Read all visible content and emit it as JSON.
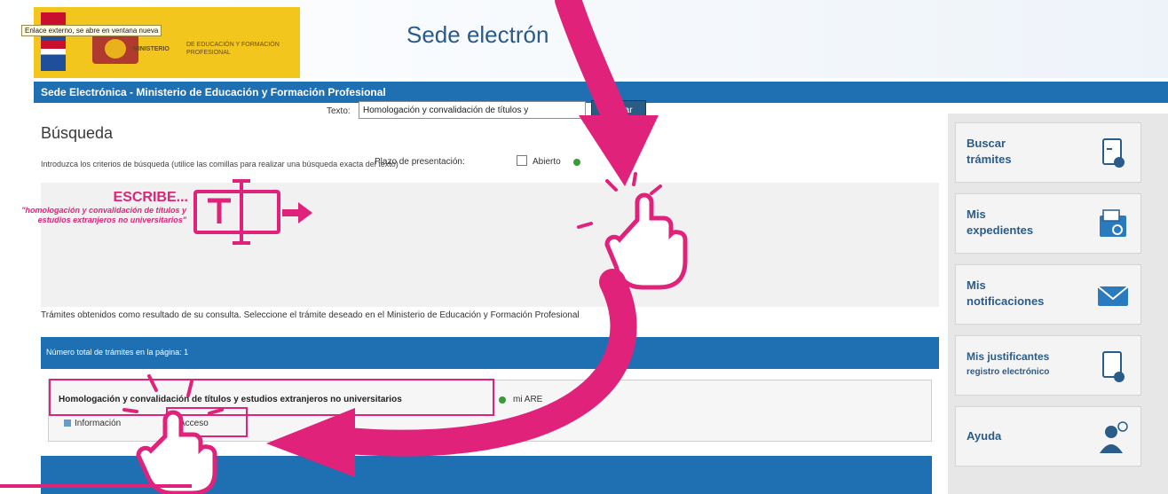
{
  "header": {
    "tooltip": "Enlace externo, se abre en ventana nueva",
    "logo_line1": "MINISTERIO",
    "logo_line2": "DE EDUCACIÓN Y FORMACIÓN PROFESIONAL",
    "site_title": "Sede electrón"
  },
  "bluebar": {
    "title": "Sede Electrónica - Ministerio de Educación y Formación Profesional"
  },
  "main": {
    "heading": "Búsqueda",
    "intro": "Introduzca los criterios de búsqueda (utilice las comillas para realizar una búsqueda exacta del texto)",
    "texto_label": "Texto:",
    "texto_value": "Homologación y convalidación de títulos y",
    "buscar_label": "Buscar",
    "plazo_label": "Plazo de presentación:",
    "abierto_label": "Abierto",
    "results_text": "Trámites obtenidos como resultado de su consulta. Seleccione el trámite deseado en el Ministerio de Educación y Formación Profesional",
    "results_bar": "Número total de trámites en la página: 1",
    "result_title": "Homologación y convalidación de títulos y estudios extranjeros no universitarios",
    "result_code": "mi ARE",
    "info_link": "Información",
    "acceso_link": "Acceso"
  },
  "sidebar": {
    "items": [
      {
        "label_1": "Buscar",
        "label_2": "trámites",
        "icon": "search-document-icon"
      },
      {
        "label_1": "Mis",
        "label_2": "expedientes",
        "icon": "folder-search-icon"
      },
      {
        "label_1": "Mis",
        "label_2": "notificaciones",
        "icon": "envelope-icon"
      },
      {
        "label_1": "Mis justificantes",
        "label_2": "registro electrónico",
        "icon": "document-receipt-icon"
      },
      {
        "label_1": "Ayuda",
        "label_2": "",
        "icon": "user-help-icon"
      }
    ]
  },
  "overlay": {
    "escribe_title": "ESCRIBE...",
    "escribe_desc": "\"homologación y convalidación de títulos y estudios extranjeros no universitarios\"",
    "colors": {
      "accent": "#e0227a",
      "blue": "#1f6fb3"
    }
  }
}
